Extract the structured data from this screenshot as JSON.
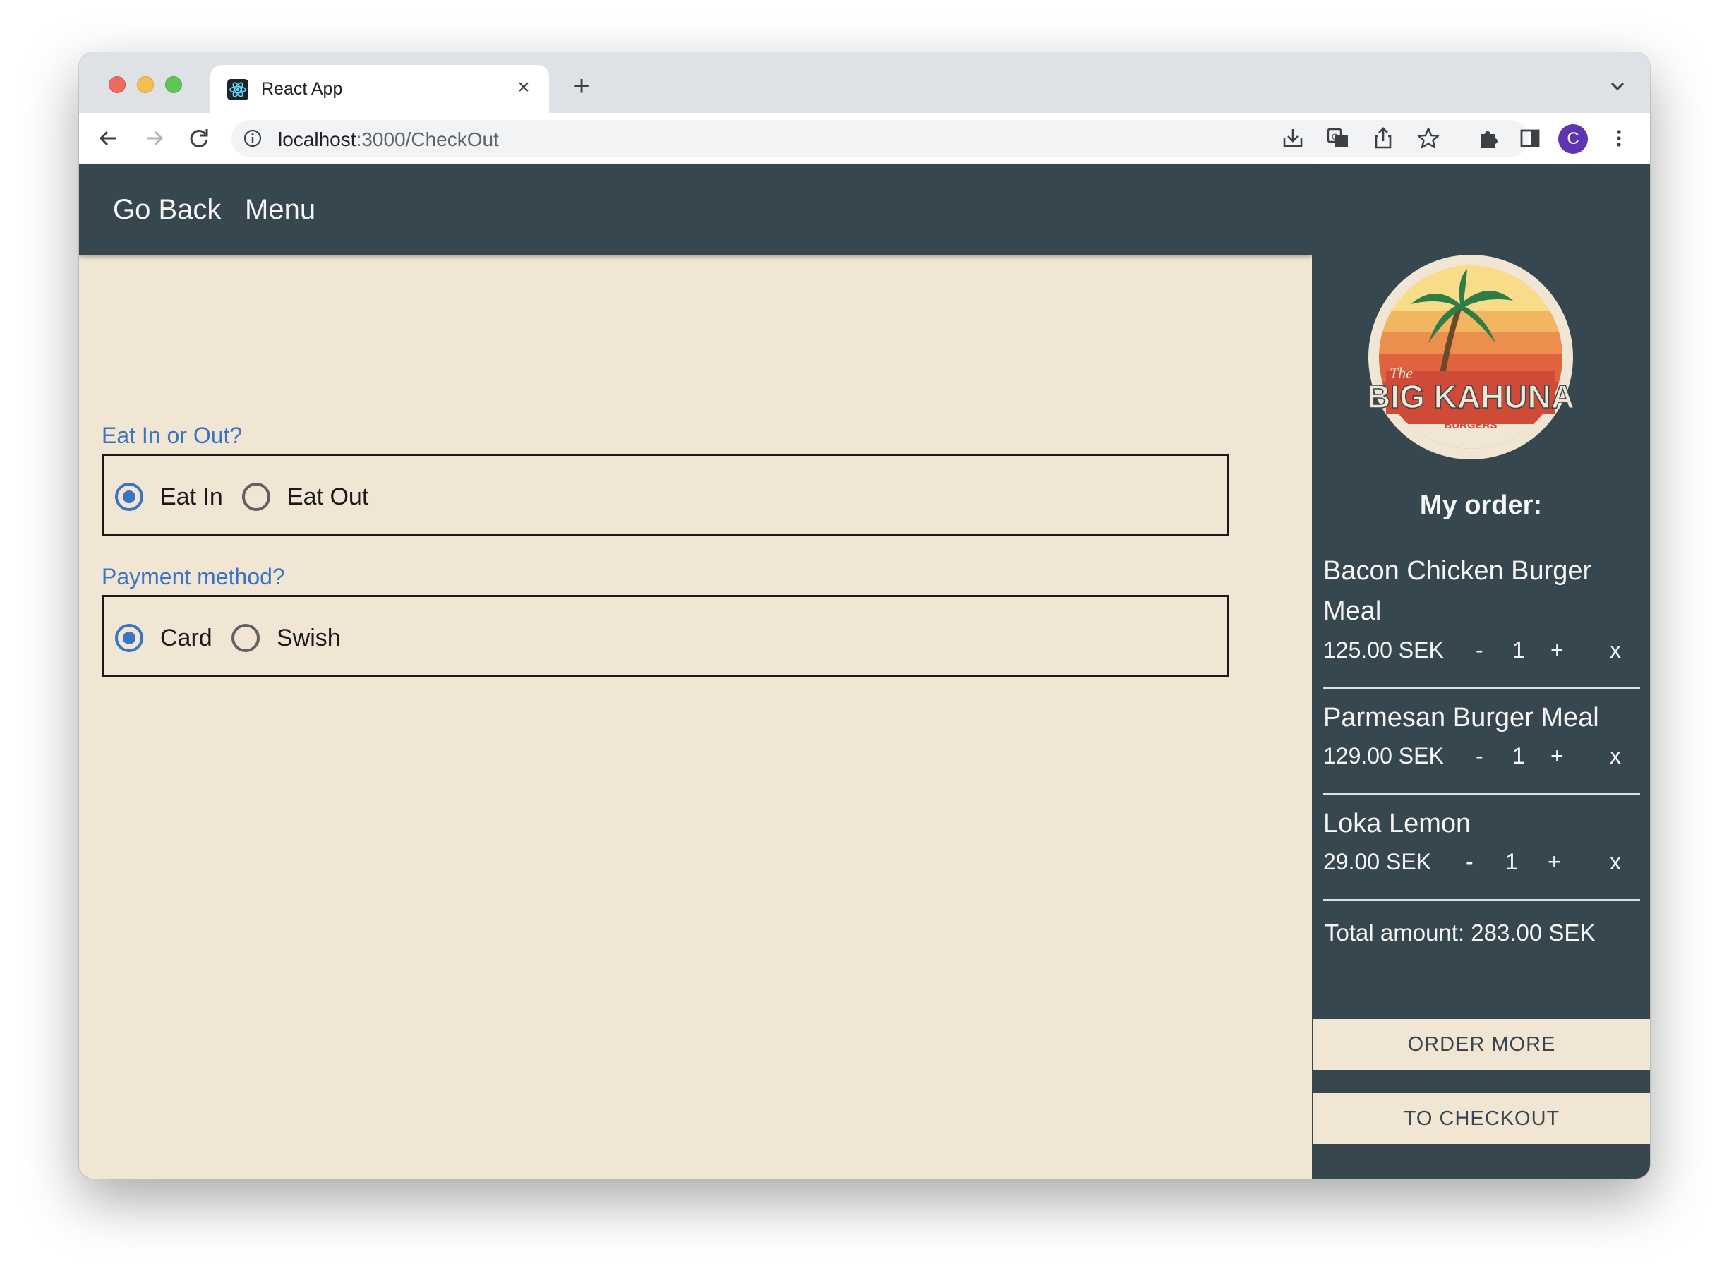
{
  "browser": {
    "tab_title": "React App",
    "url_host": "localhost",
    "url_rest": ":3000/CheckOut",
    "avatar_letter": "C"
  },
  "appbar": {
    "go_back": "Go Back",
    "menu": "Menu"
  },
  "form": {
    "dining": {
      "label": "Eat In or Out?",
      "options": [
        "Eat In",
        "Eat Out"
      ],
      "selected": "Eat In"
    },
    "payment": {
      "label": "Payment method?",
      "options": [
        "Card",
        "Swish"
      ],
      "selected": "Card"
    }
  },
  "sidebar": {
    "logo_text": {
      "the": "The",
      "big": "BIG KAHUNA",
      "burgers": "BURGERS"
    },
    "order_title": "My order:",
    "items": [
      {
        "name_line1": "Bacon Chicken Burger",
        "name_line2": "Meal",
        "price": "125.00 SEK",
        "minus": "-",
        "qty": "1",
        "plus": "+",
        "remove": "x"
      },
      {
        "name_line1": "Parmesan Burger Meal",
        "price": "129.00 SEK",
        "minus": "-",
        "qty": "1",
        "plus": "+",
        "remove": "x"
      },
      {
        "name_line1": "Loka Lemon",
        "price": "29.00 SEK",
        "minus": "-",
        "qty": "1",
        "plus": "+",
        "remove": "x"
      }
    ],
    "total": "Total amount: 283.00 SEK",
    "order_more": "ORDER MORE",
    "to_checkout": "TO CHECKOUT"
  },
  "colors": {
    "header_bg": "#37474f",
    "page_bg": "#f1e6d4",
    "accent": "#3a75c4"
  }
}
